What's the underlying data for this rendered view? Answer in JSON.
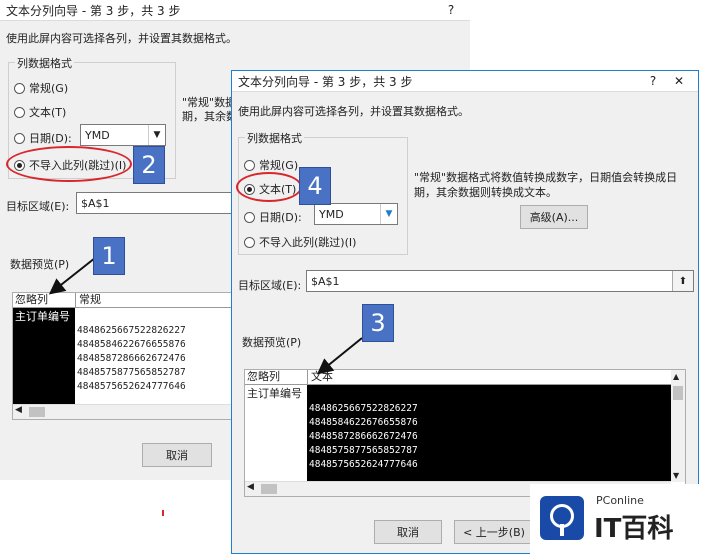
{
  "dialog_back": {
    "title": "文本分列向导 - 第 3 步，共 3 步",
    "help": "?",
    "close": "✕",
    "instruction": "使用此屏内容可选择各列，并设置其数据格式。",
    "group_label": "列数据格式",
    "radio_general": "常规(G)",
    "radio_text": "文本(T)",
    "radio_date": "日期(D):",
    "date_value": "YMD",
    "radio_skip": "不导入此列(跳过)(I)",
    "desc_partial1": "\"常规\"数据",
    "desc_partial2": "期，其余数",
    "target_label": "目标区域(E):",
    "target_value": "$A$1",
    "preview_label": "数据预览(P)",
    "col_skip": "忽略列",
    "col_general": "常规",
    "row_header": "主订单编号",
    "rows": [
      "4848625667522826227",
      "4848584622676655876",
      "4848587286662672476",
      "4848575877565852787",
      "4848575652624777646"
    ],
    "cancel": "取消"
  },
  "dialog_front": {
    "title": "文本分列向导 - 第 3 步，共 3 步",
    "help": "?",
    "close": "✕",
    "instruction": "使用此屏内容可选择各列，并设置其数据格式。",
    "group_label": "列数据格式",
    "radio_general": "常规(G)",
    "radio_text": "文本(T)",
    "radio_date": "日期(D):",
    "date_value": "YMD",
    "radio_skip": "不导入此列(跳过)(I)",
    "desc_line1": "\"常规\"数据格式将数值转换成数字，日期值会转换成日",
    "desc_line2": "期，其余数据则转换成文本。",
    "advanced": "高级(A)...",
    "target_label": "目标区域(E):",
    "target_value": "$A$1",
    "collapse_icon": "⬆",
    "preview_label": "数据预览(P)",
    "col_skip": "忽略列",
    "col_text": "文本",
    "row_header": "主订单编号",
    "rows": [
      "4848625667522826227",
      "4848584622676655876",
      "4848587286662672476",
      "4848575877565852787",
      "4848575652624777646"
    ],
    "cancel": "取消",
    "back": "< 上一步(B)"
  },
  "badges": {
    "b1": "1",
    "b2": "2",
    "b3": "3",
    "b4": "4"
  },
  "watermark": {
    "brand_small": "PConline",
    "brand_big": "IT百科"
  },
  "colors": {
    "badge": "#4a72c4",
    "highlight": "#d9262b",
    "border_accent": "#1e7fd1"
  }
}
